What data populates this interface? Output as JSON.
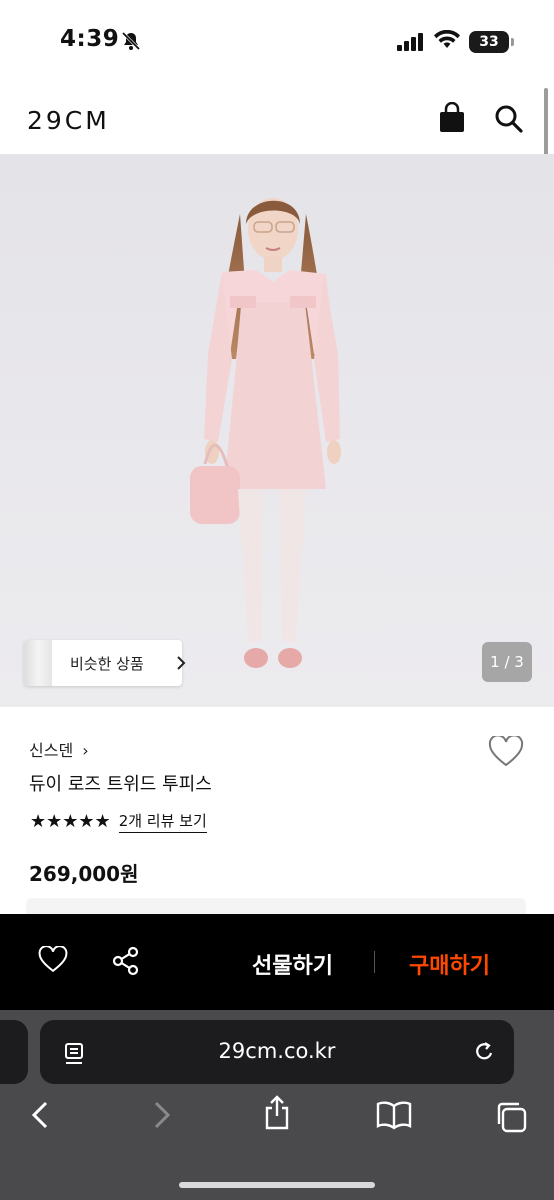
{
  "status_bar": {
    "time": "4:39",
    "battery": "33"
  },
  "header": {
    "logo": "29CM"
  },
  "gallery": {
    "similar_label": "비슷한 상품",
    "page_indicator": "1 / 3"
  },
  "product": {
    "brand": "신스덴",
    "brand_chevron": "›",
    "name": "듀이 로즈 트위드 투피스",
    "rating_stars": "★★★★★",
    "review_link": "2개 리뷰 보기",
    "price": "269,000원"
  },
  "action_bar": {
    "gift_label": "선물하기",
    "buy_label": "구매하기",
    "buy_color": "#ff4800"
  },
  "browser": {
    "url": "29cm.co.kr"
  },
  "icons": [
    "bell-off-icon",
    "signal-icon",
    "wifi-icon",
    "battery-icon",
    "shopping-bag-icon",
    "search-icon",
    "chevron-right-icon",
    "heart-icon",
    "share-icon",
    "reader-icon",
    "reload-icon",
    "back-icon",
    "forward-icon",
    "share-sheet-icon",
    "bookmarks-icon",
    "tabs-icon"
  ]
}
